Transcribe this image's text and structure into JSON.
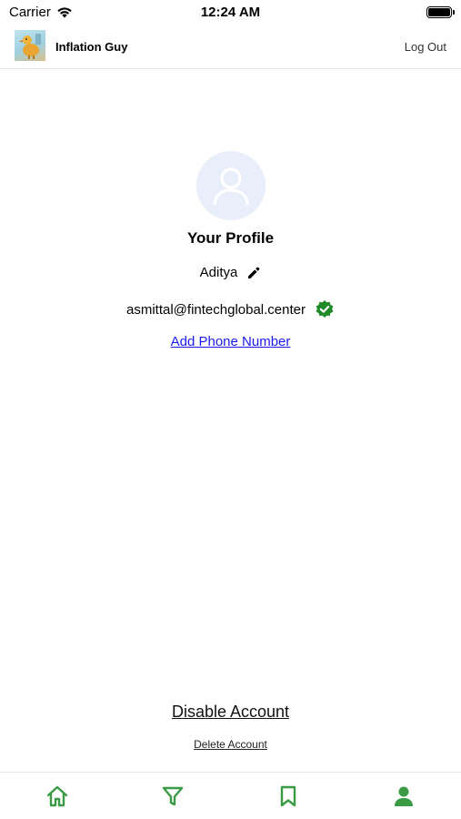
{
  "status_bar": {
    "carrier": "Carrier",
    "time": "12:24 AM"
  },
  "header": {
    "app_title": "Inflation Guy",
    "logout_label": "Log Out"
  },
  "profile": {
    "title": "Your Profile",
    "name": "Aditya",
    "email": "asmittal@fintechglobal.center",
    "email_verified": true,
    "add_phone_label": "Add Phone Number"
  },
  "account_actions": {
    "disable_label": "Disable Account",
    "delete_label": "Delete Account"
  },
  "tab_bar": {
    "accent_color": "#3a9b44",
    "tabs": [
      {
        "icon": "home-icon",
        "active": false
      },
      {
        "icon": "filter-icon",
        "active": false
      },
      {
        "icon": "bookmark-icon",
        "active": false
      },
      {
        "icon": "person-icon",
        "active": true
      }
    ]
  },
  "colors": {
    "verified_badge": "#1f8a2a",
    "link": "#1a1aee",
    "avatar_bg": "#e9eefb"
  }
}
